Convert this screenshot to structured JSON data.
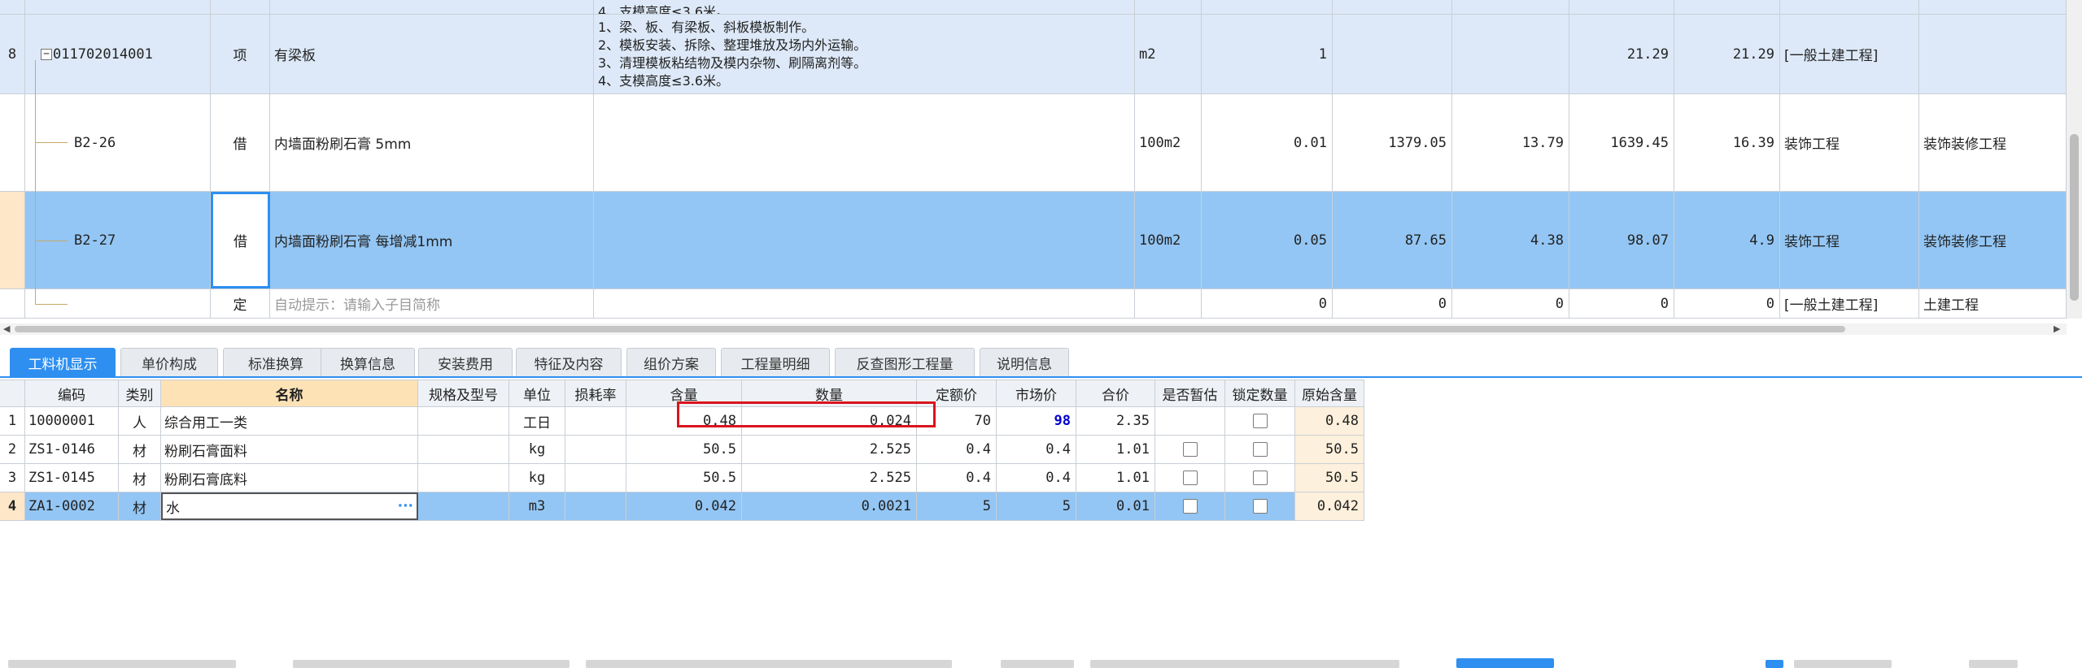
{
  "top_grid": {
    "top_cut_text": "4、支模高度≤3.6米。",
    "rows": [
      {
        "index": "8",
        "code": "011702014001",
        "type": "项",
        "name": "有梁板",
        "description": "1、梁、板、有梁板、斜板模板制作。\n2、模板安装、拆除、整理堆放及场内外运输。\n3、清理模板粘结物及模内杂物、刷隔离剂等。\n4、支模高度≤3.6米。",
        "unit": "m2",
        "quantity": "1",
        "price": "",
        "total": "",
        "unit_price": "21.29",
        "sum": "21.29",
        "category": "[一般土建工程]",
        "major": ""
      },
      {
        "index": "",
        "code": "B2-26",
        "type": "借",
        "name": "内墙面粉刷石膏 5mm",
        "description": "",
        "unit": "100m2",
        "quantity": "0.01",
        "price": "1379.05",
        "total": "13.79",
        "unit_price": "1639.45",
        "sum": "16.39",
        "category": "装饰工程",
        "major": "装饰装修工程"
      },
      {
        "index": "",
        "code": "B2-27",
        "type": "借",
        "name": "内墙面粉刷石膏 每增减1mm",
        "description": "",
        "unit": "100m2",
        "quantity": "0.05",
        "price": "87.65",
        "total": "4.38",
        "unit_price": "98.07",
        "sum": "4.9",
        "category": "装饰工程",
        "major": "装饰装修工程"
      },
      {
        "index": "",
        "code": "",
        "type": "定",
        "name": "自动提示：请输入子目简称",
        "description": "",
        "unit": "",
        "quantity": "0",
        "price": "0",
        "total": "0",
        "unit_price": "0",
        "sum": "0",
        "category": "[一般土建工程]",
        "major": "土建工程"
      }
    ]
  },
  "tabs": [
    "工料机显示",
    "单价构成",
    "标准换算",
    "换算信息",
    "安装费用",
    "特征及内容",
    "组价方案",
    "工程量明细",
    "反查图形工程量",
    "说明信息"
  ],
  "lower_grid": {
    "headers": [
      "编码",
      "类别",
      "名称",
      "规格及型号",
      "单位",
      "损耗率",
      "含量",
      "数量",
      "定额价",
      "市场价",
      "合价",
      "是否暂估",
      "锁定数量",
      "原始含量"
    ],
    "rows": [
      {
        "index": "1",
        "code": "10000001",
        "cat": "人",
        "name": "综合用工一类",
        "spec": "",
        "unit": "工日",
        "loss": "",
        "content": "0.48",
        "qty": "0.024",
        "base": "70",
        "market": "98",
        "total": "2.35",
        "provisional": false,
        "locked": false,
        "orig": "0.48"
      },
      {
        "index": "2",
        "code": "ZS1-0146",
        "cat": "材",
        "name": "粉刷石膏面料",
        "spec": "",
        "unit": "kg",
        "loss": "",
        "content": "50.5",
        "qty": "2.525",
        "base": "0.4",
        "market": "0.4",
        "total": "1.01",
        "provisional": false,
        "locked": false,
        "orig": "50.5"
      },
      {
        "index": "3",
        "code": "ZS1-0145",
        "cat": "材",
        "name": "粉刷石膏底料",
        "spec": "",
        "unit": "kg",
        "loss": "",
        "content": "50.5",
        "qty": "2.525",
        "base": "0.4",
        "market": "0.4",
        "total": "1.01",
        "provisional": false,
        "locked": false,
        "orig": "50.5"
      },
      {
        "index": "4",
        "code": "ZA1-0002",
        "cat": "材",
        "name": "水",
        "spec": "",
        "unit": "m3",
        "loss": "",
        "content": "0.042",
        "qty": "0.0021",
        "base": "5",
        "market": "5",
        "total": "0.01",
        "provisional": false,
        "locked": false,
        "orig": "0.042"
      }
    ],
    "edit_ellipsis": "···"
  },
  "colors": {
    "accent": "#2e8ff0",
    "row_selected": "#93c6f4",
    "row_light": "#dde9f8",
    "market_highlight": "#0000cc",
    "annotation": "#d9141e"
  }
}
